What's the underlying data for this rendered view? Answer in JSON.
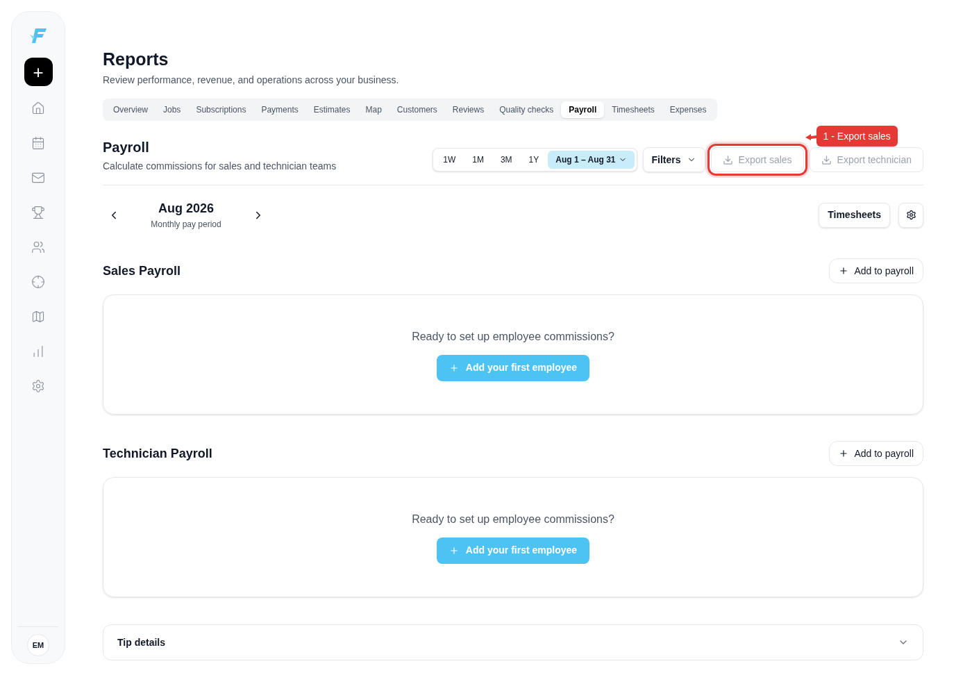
{
  "sidebar": {
    "new_button": "+",
    "user_initials": "EM",
    "items": [
      {
        "kind": "home"
      },
      {
        "kind": "calendar"
      },
      {
        "kind": "mail"
      },
      {
        "kind": "trophy"
      },
      {
        "kind": "users"
      },
      {
        "kind": "target"
      },
      {
        "kind": "map"
      },
      {
        "kind": "chart"
      },
      {
        "kind": "settings"
      }
    ]
  },
  "page": {
    "title": "Reports",
    "subtitle": "Review performance, revenue, and operations across your business."
  },
  "tabs": [
    {
      "label": "Overview",
      "selected": false
    },
    {
      "label": "Jobs",
      "selected": false
    },
    {
      "label": "Subscriptions",
      "selected": false
    },
    {
      "label": "Payments",
      "selected": false
    },
    {
      "label": "Estimates",
      "selected": false
    },
    {
      "label": "Map",
      "selected": false
    },
    {
      "label": "Customers",
      "selected": false
    },
    {
      "label": "Reviews",
      "selected": false
    },
    {
      "label": "Quality checks",
      "selected": false
    },
    {
      "label": "Payroll",
      "selected": true
    },
    {
      "label": "Timesheets",
      "selected": false
    },
    {
      "label": "Expenses",
      "selected": false
    }
  ],
  "section": {
    "title": "Payroll",
    "subtitle": "Calculate commissions for sales and technician teams"
  },
  "ranges": [
    {
      "label": "1W",
      "selected": false,
      "kind": "preset"
    },
    {
      "label": "1M",
      "selected": false,
      "kind": "preset"
    },
    {
      "label": "3M",
      "selected": false,
      "kind": "preset"
    },
    {
      "label": "1Y",
      "selected": false,
      "kind": "preset"
    },
    {
      "label": "Aug 1 – Aug 31",
      "selected": true,
      "kind": "custom"
    }
  ],
  "filters": "Filters",
  "export_buttons": [
    {
      "label": "Export sales",
      "highlighted": true
    },
    {
      "label": "Export technician",
      "highlighted": false
    }
  ],
  "annotation": {
    "label": "1 - Export sales"
  },
  "period": {
    "month": "Aug 2026",
    "caption": "Monthly pay period",
    "timesheets_button": "Timesheets"
  },
  "payrolls": [
    {
      "title": "Sales Payroll",
      "add_button": "Add to payroll",
      "empty_text": "Ready to set up employee commissions?",
      "cta": "Add your first employee"
    },
    {
      "title": "Technician Payroll",
      "add_button": "Add to payroll",
      "empty_text": "Ready to set up employee commissions?",
      "cta": "Add your first employee"
    }
  ],
  "tip_details": {
    "title": "Tip details",
    "expanded": false
  }
}
